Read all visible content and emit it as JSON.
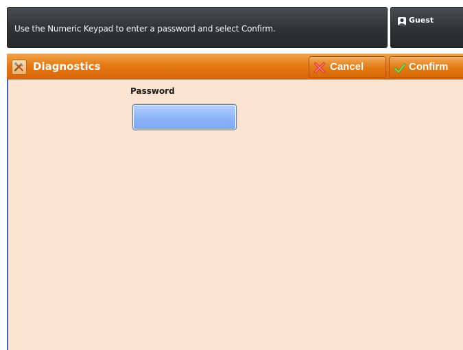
{
  "top_bar": {
    "message": "Use the Numeric Keypad to enter a password and select Confirm."
  },
  "user": {
    "name": "Guest",
    "icon": "user-icon"
  },
  "header": {
    "title": "Diagnostics",
    "title_icon": "tools-icon",
    "cancel_label": "Cancel",
    "cancel_icon": "cancel-x-icon",
    "confirm_label": "Confirm",
    "confirm_icon": "checkmark-icon",
    "accent_color": "#e57a12"
  },
  "form": {
    "password_label": "Password",
    "password_value": ""
  },
  "colors": {
    "content_background": "#fde4d2",
    "input_fill": "#8ab2f8",
    "top_bar": "#2f3336"
  }
}
